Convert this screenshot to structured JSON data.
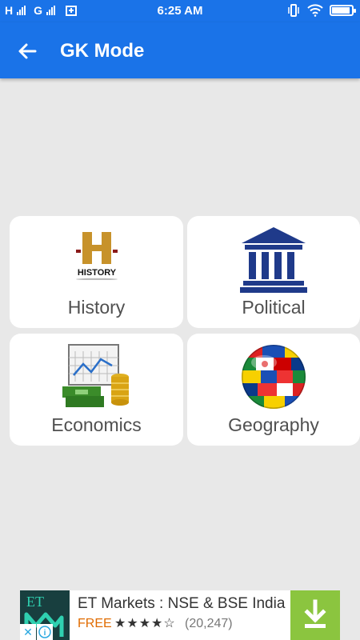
{
  "status_bar": {
    "left_text_1": "H",
    "left_text_2": "G",
    "time": "6:25 AM"
  },
  "app_bar": {
    "title": "GK Mode"
  },
  "categories": [
    {
      "label": "History",
      "icon": "history-logo-icon",
      "logo_text": "HISTORY"
    },
    {
      "label": "Political",
      "icon": "government-building-icon"
    },
    {
      "label": "Economics",
      "icon": "money-chart-icon"
    },
    {
      "label": "Geography",
      "icon": "flag-globe-icon"
    }
  ],
  "ad": {
    "title": "ET Markets : NSE & BSE India",
    "price": "FREE",
    "stars": "★★★★☆",
    "rating_count": "(20,247)",
    "logo_text": "ET",
    "close_glyph": "✕",
    "info_glyph": "i"
  },
  "colors": {
    "primary": "#1a73e8",
    "background": "#e8e8e8",
    "ad_download": "#8bc53f"
  }
}
